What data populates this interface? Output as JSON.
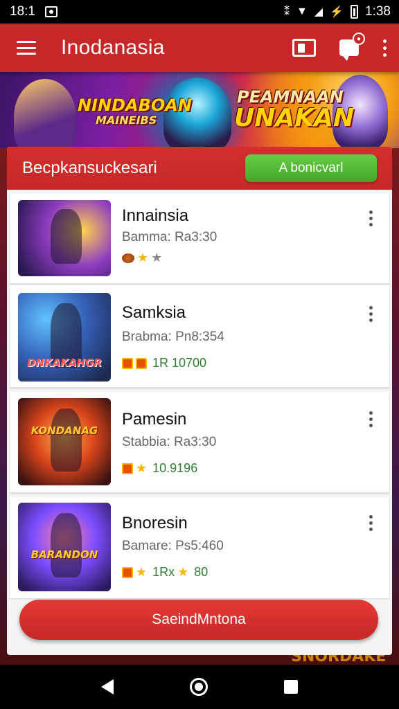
{
  "status_bar": {
    "time_left": "18:1",
    "time_right": "1:38"
  },
  "app_bar": {
    "title": "Inodanasia"
  },
  "banner": {
    "left_line1": "NINDABOAN",
    "left_line2": "MAINEIBS",
    "right_line1": "PEAMNAAN",
    "right_line2": "UNAKAN"
  },
  "panel": {
    "title": "Becpkansuckesari",
    "action_label": "A bonicvarl"
  },
  "games": [
    {
      "title": "Innainsia",
      "subtitle": "Bamma: Ra3:30",
      "meta_value": "",
      "thumb_label": "",
      "icons": [
        "coin-icon",
        "star-icon",
        "star-outline-icon"
      ]
    },
    {
      "title": "Samksia",
      "subtitle": "Brabma: Pn8:354",
      "meta_value": "1R 10700",
      "thumb_label": "DNKAKAHGR",
      "icons": [
        "gift-icon",
        "gift-icon"
      ]
    },
    {
      "title": "Pamesin",
      "subtitle": "Stabbia: Ra3:30",
      "meta_value": "10.9196",
      "thumb_label": "KONDANAG",
      "icons": [
        "gift-icon",
        "star-icon"
      ]
    },
    {
      "title": "Bnoresin",
      "subtitle": "Bamare: Ps5:460",
      "meta_value": "80",
      "meta_mid": "1Rx",
      "thumb_label": "BARANDON",
      "icons": [
        "gift-icon",
        "star-icon",
        "star-icon"
      ]
    }
  ],
  "bottom_button": {
    "label": "SaeindMntona"
  },
  "background_text": "SNORDAKE",
  "colors": {
    "primary": "#c62828",
    "accent_green": "#4caf50",
    "star": "#f5b700"
  }
}
